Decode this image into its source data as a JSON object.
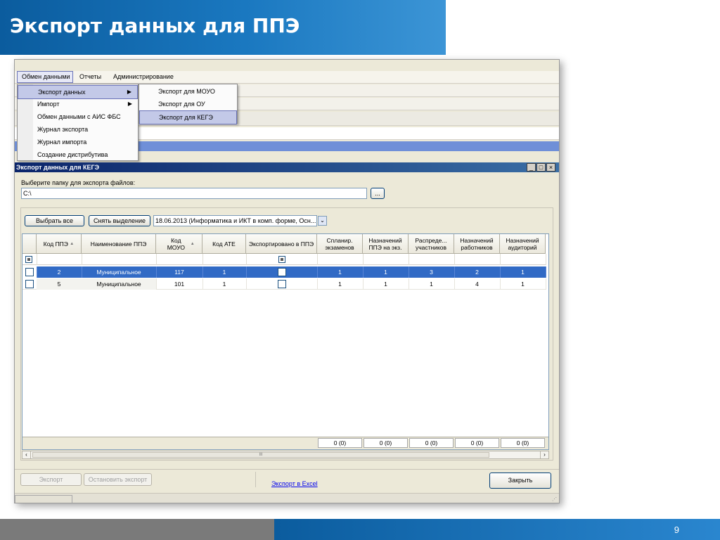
{
  "slide": {
    "title": "Экспорт данных для ППЭ",
    "page_number": "9"
  },
  "app": {
    "menubar": [
      "Обмен данными",
      "Отчеты",
      "Администрирование"
    ],
    "menu_main": [
      "Экспорт данных",
      "Импорт",
      "Обмен данными с АИС ФБС",
      "Журнал экспорта",
      "Журнал импорта",
      "Создание дистрибутива"
    ],
    "menu_sub": [
      "Экспорт для МОУО",
      "Экспорт для ОУ",
      "Экспорт для КЕГЭ"
    ]
  },
  "dialog": {
    "title": "Экспорт данных для КЕГЭ",
    "caption_buttons": [
      "_",
      "□",
      "×"
    ],
    "folder_label": "Выберите папку для экспорта файлов:",
    "folder_value": "C:\\",
    "browse_label": "...",
    "select_all": "Выбрать все",
    "deselect": "Снять выделение",
    "exam_select": "18.06.2013 (Информатика и ИКТ в комп. форме, Осн...",
    "columns": [
      "Код ППЭ",
      "Наименование ППЭ",
      "Код МОУО",
      "Код АТЕ",
      "Экспортировано в ППЭ",
      "Спланир. экзаменов",
      "Назначений ППЭ на экз.",
      "Распреде... участников",
      "Назначений работников",
      "Назначений аудиторий"
    ],
    "rows": [
      {
        "kod_ppe": "2",
        "name": "Муниципальное",
        "kod_mouo": "117",
        "kod_ate": "1",
        "exported": false,
        "planned": "1",
        "assigned_ppe": "1",
        "distributed": "3",
        "workers": "2",
        "rooms": "1"
      },
      {
        "kod_ppe": "5",
        "name": "Муниципальное",
        "kod_mouo": "101",
        "kod_ate": "1",
        "exported": false,
        "planned": "1",
        "assigned_ppe": "1",
        "distributed": "1",
        "workers": "4",
        "rooms": "1"
      }
    ],
    "footer_totals": [
      "0 (0)",
      "0 (0)",
      "0 (0)",
      "0 (0)",
      "0 (0)"
    ],
    "scroll_grip": "III",
    "export_button": "Экспорт",
    "stop_button": "Остановить экспорт",
    "excel_link": "Экспорт в Excel",
    "close_button": "Закрыть",
    "sort_indicator": "▲"
  }
}
